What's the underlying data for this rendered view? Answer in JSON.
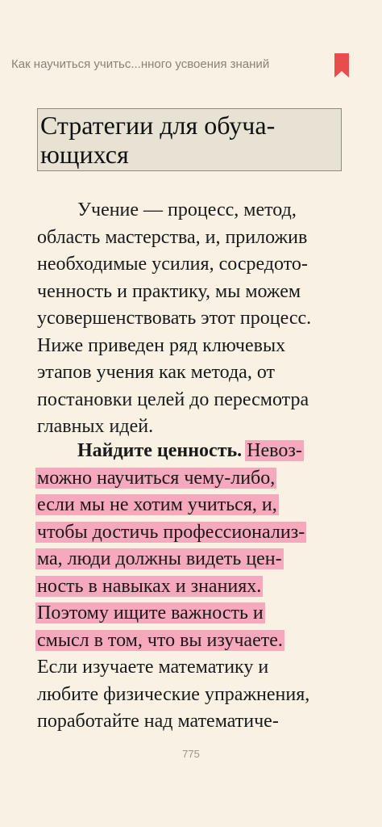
{
  "header": {
    "book_title": "Как научиться учитьс...нного усвоения знаний",
    "bookmark_color": "#e84c4c"
  },
  "heading": {
    "line1": "Стратегии для обуча-",
    "line2": "ющихся"
  },
  "paragraph1": {
    "lines": [
      "Учение — процесс, метод,",
      "область мастерства, и, приложив",
      "необходимые усилия, сосредото-",
      "ченность и практику, мы можем",
      "усовершенствовать этот процесс.",
      "Ниже приведен ряд ключевых",
      "этапов учения как метода, от",
      "постановки целей до пересмотра",
      "главных идей."
    ]
  },
  "paragraph2": {
    "bold_lead": "Найдите ценность.",
    "first_line_highlight": "Невоз-",
    "highlighted_lines": [
      "можно научиться чему-либо,",
      "если мы не хотим учиться, и,",
      "чтобы достичь профессионализ-",
      "ма, люди должны видеть цен-",
      "ность в навыках и знаниях.",
      "Поэтому ищите важность и",
      "смысл в том, что вы изучаете."
    ],
    "plain_lines": [
      "Если изучаете математику и",
      "любите физические упражнения,",
      "поработайте над математиче-"
    ],
    "highlight_color": "#f6a8bc"
  },
  "footer": {
    "page_number": "775"
  }
}
